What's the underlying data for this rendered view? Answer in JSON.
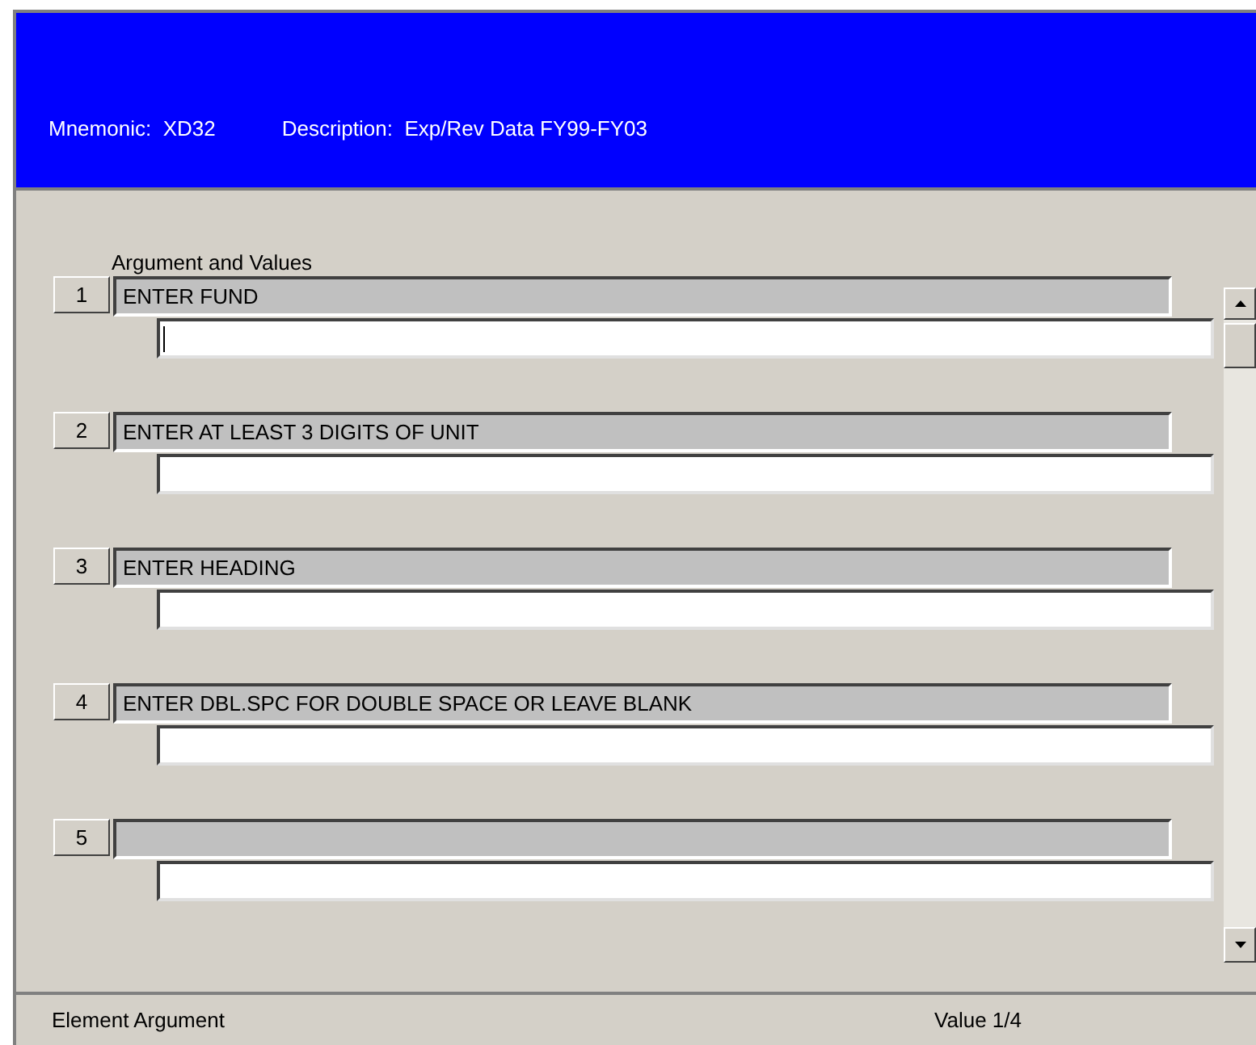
{
  "header": {
    "mnemonic_label": "Mnemonic:",
    "mnemonic": "XD32",
    "description_label": "Description:",
    "description": "Exp/Rev Data FY99-FY03"
  },
  "section_title": "Argument and Values",
  "arguments": [
    {
      "number": "1",
      "prompt": "ENTER FUND",
      "focused": true
    },
    {
      "number": "2",
      "prompt": "ENTER AT LEAST 3 DIGITS OF UNIT",
      "focused": false
    },
    {
      "number": "3",
      "prompt": "ENTER HEADING",
      "focused": false
    },
    {
      "number": "4",
      "prompt": "ENTER DBL.SPC FOR DOUBLE SPACE OR LEAVE BLANK",
      "focused": false
    },
    {
      "number": "5",
      "focused": false
    }
  ],
  "status_bar": {
    "left": "Element Argument",
    "right": "Value 1/4"
  }
}
